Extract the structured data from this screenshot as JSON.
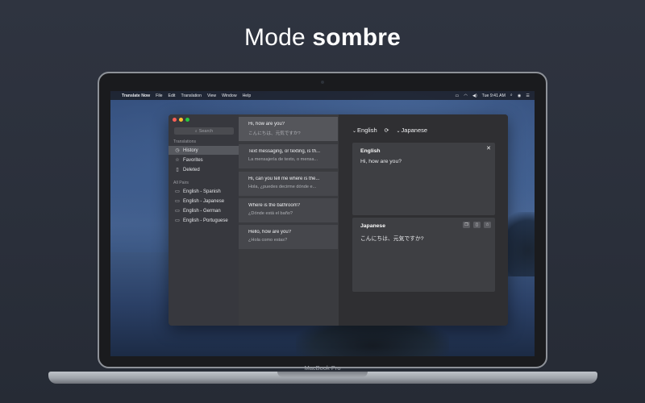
{
  "headline": {
    "normal": "Mode ",
    "bold": "sombre"
  },
  "device_label": "MacBook Pro",
  "menubar": {
    "apple": "",
    "app_name": "Translate Now",
    "items": [
      "File",
      "Edit",
      "Translation",
      "View",
      "Window",
      "Help"
    ],
    "clock": "Tue 9:41 AM"
  },
  "sidebar": {
    "search_placeholder": "Search",
    "translations_title": "Translations",
    "translations": [
      {
        "label": "History",
        "icon": "clock-icon",
        "active": true
      },
      {
        "label": "Favorites",
        "icon": "star-icon",
        "active": false
      },
      {
        "label": "Deleted",
        "icon": "trash-icon",
        "active": false
      }
    ],
    "pairs_title": "All Pairs",
    "pairs": [
      {
        "label": "English - Spanish",
        "icon": "folder-icon"
      },
      {
        "label": "English - Japanese",
        "icon": "folder-icon"
      },
      {
        "label": "English - German",
        "icon": "folder-icon"
      },
      {
        "label": "English - Portuguese",
        "icon": "folder-icon"
      }
    ]
  },
  "history": [
    {
      "source": "Hi, how are you?",
      "target": "こんにちは、元気ですか?",
      "selected": true
    },
    {
      "source": "Text messaging, or texting, is th...",
      "target": "La mensajería de texto, o mensa...",
      "selected": false
    },
    {
      "source": "Hi, can you tell me where is the...",
      "target": "Hola, ¿puedes decirme dónde e...",
      "selected": false
    },
    {
      "source": "Where is the bathroom?",
      "target": "¿Dónde está el baño?",
      "selected": false
    },
    {
      "source": "Hello, how are you?",
      "target": "¿Hola como estas?",
      "selected": false
    }
  ],
  "detail": {
    "source_lang": "English",
    "target_lang": "Japanese",
    "source_panel": {
      "title": "English",
      "text": "Hi, how are you?"
    },
    "target_panel": {
      "title": "Japanese",
      "text": "こんにちは、元気ですか?"
    }
  },
  "colors": {
    "background": "#2d323d",
    "window": "#2a2a2d",
    "sidebar_active": "#56585e",
    "panel": "#3e3f43"
  }
}
